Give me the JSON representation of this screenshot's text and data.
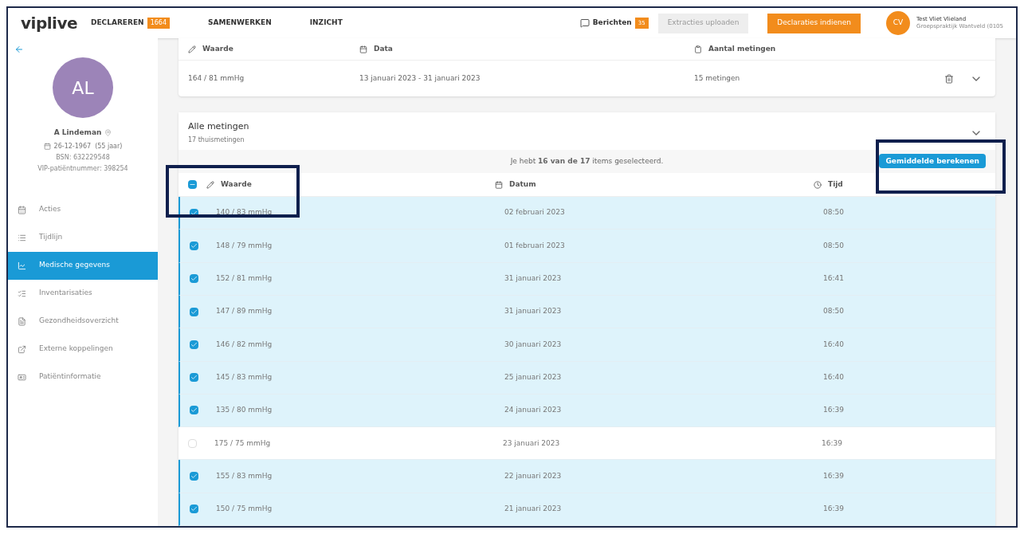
{
  "header": {
    "logo": "viplive",
    "nav": [
      {
        "label": "DECLAREREN",
        "badge": "1664"
      },
      {
        "label": "SAMENWERKEN"
      },
      {
        "label": "INZICHT"
      }
    ],
    "messages": {
      "label": "Berichten",
      "badge": "35"
    },
    "upload_button": "Extracties uploaden",
    "submit_button": "Declaraties indienen",
    "user": {
      "initials": "CV",
      "name": "Test Vliet Vlieland",
      "practice": "Groepspraktijk Wantveld (0105"
    }
  },
  "patient": {
    "initials": "AL",
    "name": "A Lindeman",
    "birth": "26-12-1967  (55 jaar)",
    "bsn": "BSN: 632229548",
    "vip": "VIP-patiëntnummer: 398254"
  },
  "sidebar": {
    "items": [
      {
        "label": "Acties",
        "selected": false
      },
      {
        "label": "Tijdlijn",
        "selected": false
      },
      {
        "label": "Medische gegevens",
        "selected": true
      },
      {
        "label": "Inventarisaties",
        "selected": false
      },
      {
        "label": "Gezondheidsoverzicht",
        "selected": false
      },
      {
        "label": "Externe koppelingen",
        "selected": false
      },
      {
        "label": "Patiëntinformatie",
        "selected": false
      }
    ]
  },
  "average_card": {
    "columns": [
      "Waarde",
      "Data",
      "Aantal metingen"
    ],
    "row": [
      "164 / 81 mmHg",
      "13 januari 2023 - 31 januari 2023",
      "15 metingen"
    ]
  },
  "measurements": {
    "title": "Alle metingen",
    "subtitle": "17 thuismetingen",
    "selection_text": "Je hebt **16 van de 17** items geselecteerd.",
    "average_button": "Gemiddelde berekenen",
    "select_all": {
      "checked": true,
      "indeterminate": true
    },
    "columns": [
      "Waarde",
      "Datum",
      "Tijd"
    ],
    "rows": [
      {
        "value": "140 / 83 mmHg",
        "date": "02 februari 2023",
        "time": "08:50",
        "selected": true
      },
      {
        "value": "148 / 79 mmHg",
        "date": "01 februari 2023",
        "time": "08:50",
        "selected": true
      },
      {
        "value": "152 / 81 mmHg",
        "date": "31 januari 2023",
        "time": "16:41",
        "selected": true
      },
      {
        "value": "147 / 89 mmHg",
        "date": "31 januari 2023",
        "time": "08:50",
        "selected": true
      },
      {
        "value": "146 / 82 mmHg",
        "date": "30 januari 2023",
        "time": "16:40",
        "selected": true
      },
      {
        "value": "145 / 83 mmHg",
        "date": "25 januari 2023",
        "time": "16:40",
        "selected": true
      },
      {
        "value": "135 / 80 mmHg",
        "date": "24 januari 2023",
        "time": "16:39",
        "selected": true
      },
      {
        "value": "175 / 75 mmHg",
        "date": "23 januari 2023",
        "time": "16:39",
        "selected": false
      },
      {
        "value": "155 / 83 mmHg",
        "date": "22 januari 2023",
        "time": "16:39",
        "selected": true
      },
      {
        "value": "150 / 75 mmHg",
        "date": "21 januari 2023",
        "time": "16:39",
        "selected": true
      }
    ]
  }
}
